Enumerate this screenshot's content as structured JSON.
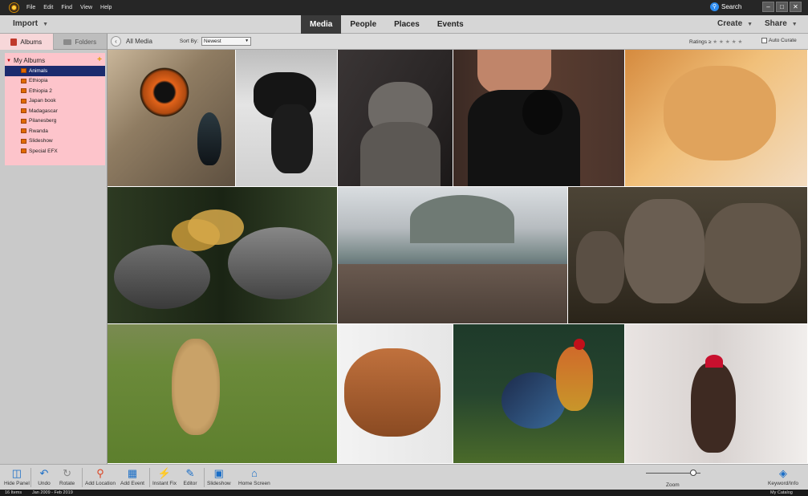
{
  "menubar": {
    "items": [
      "File",
      "Edit",
      "Find",
      "View",
      "Help"
    ],
    "search_label": "Search"
  },
  "topbar": {
    "import_label": "Import",
    "modes": [
      "Media",
      "People",
      "Places",
      "Events"
    ],
    "active_mode": "Media",
    "create_label": "Create",
    "share_label": "Share"
  },
  "sidebar": {
    "tabs": [
      "Albums",
      "Folders"
    ],
    "active_tab": "Albums",
    "section_title": "My Albums",
    "albums": [
      "Animals",
      "Ethiopia",
      "Ethiopia 2",
      "Japan book",
      "Madagascar",
      "Pilanesberg",
      "Rwanda",
      "Slideshow",
      "Special EFX"
    ],
    "selected_album": "Animals"
  },
  "browser": {
    "breadcrumb": "All Media",
    "sort_label": "Sort By:",
    "sort_value": "Newest",
    "ratings_label": "Ratings ≥",
    "stars": "★★★★★",
    "auto_curate_label": "Auto Curate",
    "auto_curate_checked": false
  },
  "photos": [
    {
      "subject": "owl-eye"
    },
    {
      "subject": "black-dog"
    },
    {
      "subject": "grey-kitten"
    },
    {
      "subject": "woman-with-black-cat"
    },
    {
      "subject": "ginger-cat"
    },
    {
      "subject": "crowned-cranes"
    },
    {
      "subject": "hallstatt-village"
    },
    {
      "subject": "elephants"
    },
    {
      "subject": "cheetah"
    },
    {
      "subject": "dogue-de-bordeaux"
    },
    {
      "subject": "rooster"
    },
    {
      "subject": "person-in-snow"
    }
  ],
  "toolbar": {
    "hide_panel": "Hide Panel",
    "undo": "Undo",
    "rotate": "Rotate",
    "add_location": "Add Location",
    "add_event": "Add Event",
    "instant_fix": "Instant Fix",
    "editor": "Editor",
    "slideshow": "Slideshow",
    "home_screen": "Home Screen",
    "zoom": "Zoom",
    "zoom_level": 0.87,
    "keyword_info": "Keyword/Info"
  },
  "status": {
    "items_count": "16 Items",
    "date_range": "Jan 2009 - Feb 2019",
    "catalog": "My Catalog"
  },
  "colors": {
    "selected_album_bg": "#1b2b6e",
    "albums_bg": "#fdc4cb",
    "accent_blue": "#2d8cf0",
    "active_mode_bg": "#3a3a3a"
  }
}
